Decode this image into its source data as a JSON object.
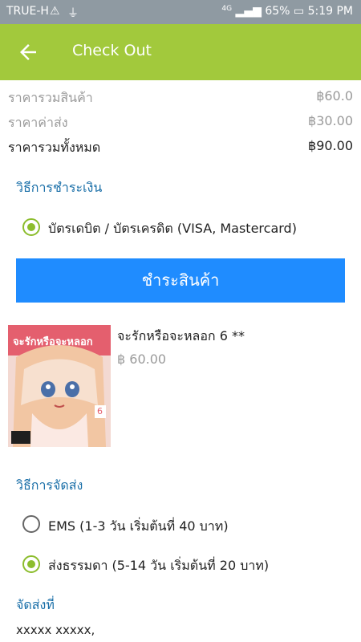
{
  "status_bar": {
    "carrier": "TRUE-H",
    "network": "4G",
    "battery": "65%",
    "time": "5:19 PM"
  },
  "app_bar": {
    "title": "Check Out"
  },
  "summary": {
    "subtotal_label": "ราคารวมสินค้า",
    "subtotal_value": "฿60.0",
    "shipping_label": "ราคาค่าส่ง",
    "shipping_value": "฿30.00",
    "total_label": "ราคารวมทั้งหมด",
    "total_value": "฿90.00"
  },
  "payment": {
    "section_title": "วิธีการชำระเงิน",
    "option_label": "บัตรเดบิต / บัตรเครดิต (VISA, Mastercard)",
    "pay_button": "ชำระสินค้า"
  },
  "product": {
    "name": "จะรักหรือจะหลอก 6 **",
    "price": "฿ 60.00",
    "cover_title": "จะรักหรือจะหลอก",
    "cover_volume": "6"
  },
  "shipping": {
    "section_title": "วิธีการจัดส่ง",
    "options": [
      "EMS (1-3 วัน เริ่มต้นที่  40 บาท)",
      "ส่งธรรมดา (5-14 วัน เริ่มต้นที่  20 บาท)"
    ],
    "selected_index": 1
  },
  "address": {
    "section_title": "จัดส่งที่",
    "line1": "xxxxx xxxxx,"
  },
  "colors": {
    "app_bar": "#a2c93c",
    "pay_button": "#1f8cff",
    "section_title": "#1a6fa8",
    "radio_selected": "#8cbd2d"
  }
}
